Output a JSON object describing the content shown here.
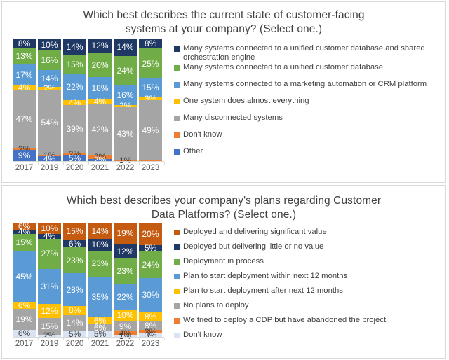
{
  "charts": [
    {
      "id": "customer-facing-systems",
      "title": "Which best describes the current state of customer-facing systems at your company? (Select one.)",
      "title_line1": "Which best describes the current state of customer-facing",
      "title_line2": "systems at your company? (Select one.)",
      "legend": [
        {
          "label": "Many systems connected to a unified customer database and shared orchestration engine",
          "color": "#1F3864"
        },
        {
          "label": "Many systems connected to a unified customer database",
          "color": "#70AD47"
        },
        {
          "label": "Many systems connected to a marketing automation or CRM platform",
          "color": "#5B9BD5"
        },
        {
          "label": "One system does almost everything",
          "color": "#FFC000"
        },
        {
          "label": "Many disconnected systems",
          "color": "#A5A5A5"
        },
        {
          "label": "Don't know",
          "color": "#ED7D31"
        },
        {
          "label": "Other",
          "color": "#4472C4"
        }
      ]
    },
    {
      "id": "cdp-plans",
      "title": "Which best describes your company's plans regarding Customer Data Platforms? (Select one.)",
      "title_line1": "Which best describes your company's plans regarding Customer",
      "title_line2": "Data Platforms? (Select one.)",
      "legend": [
        {
          "label": "Deployed and delivering significant value",
          "color": "#C55A11"
        },
        {
          "label": "Deployed but delivering little or no value",
          "color": "#1F3864"
        },
        {
          "label": "Deployment in process",
          "color": "#70AD47"
        },
        {
          "label": "Plan to start deployment within next 12 months",
          "color": "#5B9BD5"
        },
        {
          "label": "Plan to start deployment after next 12 months",
          "color": "#FFC000"
        },
        {
          "label": "No plans to deploy",
          "color": "#A5A5A5"
        },
        {
          "label": "We tried to deploy a CDP but have abandoned the project",
          "color": "#ED7D31"
        },
        {
          "label": "Don't know",
          "color": "#DAE3F3"
        }
      ]
    }
  ],
  "chart_data": [
    {
      "type": "bar",
      "stacked": true,
      "orientation": "vertical",
      "percent": true,
      "title": "Which best describes the current state of customer-facing systems at your company? (Select one.)",
      "xlabel": "",
      "ylabel": "",
      "ylim": [
        0,
        100
      ],
      "grid": false,
      "legend_position": "right",
      "categories": [
        "2017",
        "2019",
        "2020",
        "2021",
        "2022",
        "2023"
      ],
      "series": [
        {
          "name": "Many systems connected to a unified customer database and shared orchestration engine",
          "color": "#1F3864",
          "values": [
            8,
            10,
            14,
            12,
            14,
            8
          ],
          "labels": [
            "8%",
            "10%",
            "14%",
            "12%",
            "14%",
            "8%"
          ],
          "text": "light"
        },
        {
          "name": "Many systems connected to a unified customer database",
          "color": "#70AD47",
          "values": [
            13,
            16,
            15,
            20,
            24,
            25
          ],
          "labels": [
            "13%",
            "16%",
            "15%",
            "20%",
            "24%",
            "25%"
          ],
          "text": "light"
        },
        {
          "name": "Many systems connected to a marketing automation or CRM platform",
          "color": "#5B9BD5",
          "values": [
            17,
            14,
            22,
            18,
            16,
            15
          ],
          "labels": [
            "17%",
            "14%",
            "22%",
            "18%",
            "16%",
            "15%"
          ],
          "text": "light"
        },
        {
          "name": "One system does almost everything",
          "color": "#FFC000",
          "values": [
            4,
            2,
            4,
            4,
            2,
            3
          ],
          "labels": [
            "4%",
            "2%",
            "4%",
            "4%",
            "2%",
            "3%"
          ],
          "text": "light"
        },
        {
          "name": "Many disconnected systems",
          "color": "#A5A5A5",
          "values": [
            47,
            54,
            39,
            42,
            43,
            49
          ],
          "labels": [
            "47%",
            "54%",
            "39%",
            "42%",
            "43%",
            "49%"
          ],
          "text": "light"
        },
        {
          "name": "Don't know",
          "color": "#ED7D31",
          "values": [
            2,
            1,
            2,
            3,
            1,
            1
          ],
          "labels": [
            "2%",
            "1%",
            "2%",
            "3%",
            "1%",
            ""
          ],
          "text": "dark"
        },
        {
          "name": "Other",
          "color": "#4472C4",
          "values": [
            9,
            4,
            5,
            2,
            0,
            0
          ],
          "labels": [
            "9%",
            "4%",
            "5%",
            "2%",
            "",
            ""
          ],
          "text": "light"
        }
      ]
    },
    {
      "type": "bar",
      "stacked": true,
      "orientation": "vertical",
      "percent": true,
      "title": "Which best describes your company's plans regarding Customer Data Platforms? (Select one.)",
      "xlabel": "",
      "ylabel": "",
      "ylim": [
        0,
        100
      ],
      "grid": false,
      "legend_position": "right",
      "categories": [
        "2017",
        "2019",
        "2020",
        "2021",
        "2022",
        "2023"
      ],
      "series": [
        {
          "name": "Deployed and delivering significant value",
          "color": "#C55A11",
          "values": [
            6,
            10,
            15,
            14,
            19,
            20
          ],
          "labels": [
            "6%",
            "10%",
            "15%",
            "14%",
            "19%",
            "20%"
          ],
          "text": "light"
        },
        {
          "name": "Deployed but delivering little or no value",
          "color": "#1F3864",
          "values": [
            4,
            4,
            6,
            10,
            12,
            5
          ],
          "labels": [
            "4%",
            "4%",
            "6%",
            "10%",
            "12%",
            "5%"
          ],
          "text": "light"
        },
        {
          "name": "Deployment in process",
          "color": "#70AD47",
          "values": [
            15,
            27,
            23,
            23,
            23,
            24
          ],
          "labels": [
            "15%",
            "27%",
            "23%",
            "23%",
            "23%",
            "24%"
          ],
          "text": "light"
        },
        {
          "name": "Plan to start deployment within next 12 months",
          "color": "#5B9BD5",
          "values": [
            45,
            31,
            28,
            35,
            22,
            30
          ],
          "labels": [
            "45%",
            "31%",
            "28%",
            "35%",
            "22%",
            "30%"
          ],
          "text": "light"
        },
        {
          "name": "Plan to start deployment after next 12 months",
          "color": "#FFC000",
          "values": [
            6,
            12,
            8,
            6,
            10,
            8
          ],
          "labels": [
            "6%",
            "12%",
            "8%",
            "6%",
            "10%",
            "8%"
          ],
          "text": "light"
        },
        {
          "name": "No plans to deploy",
          "color": "#A5A5A5",
          "values": [
            19,
            15,
            14,
            6,
            9,
            8
          ],
          "labels": [
            "19%",
            "15%",
            "14%",
            "6%",
            "9%",
            "8%"
          ],
          "text": "light"
        },
        {
          "name": "We tried to deploy a CDP but have abandoned the project",
          "color": "#ED7D31",
          "values": [
            0,
            0,
            0,
            0,
            4,
            3
          ],
          "labels": [
            "",
            "",
            "",
            "",
            "4%",
            "3%"
          ],
          "text": "dark"
        },
        {
          "name": "Don't know",
          "color": "#DAE3F3",
          "values": [
            6,
            2,
            5,
            5,
            1,
            3
          ],
          "labels": [
            "6%",
            "2%",
            "5%",
            "5%",
            "1%",
            "3%"
          ],
          "text": "dark"
        }
      ]
    }
  ]
}
